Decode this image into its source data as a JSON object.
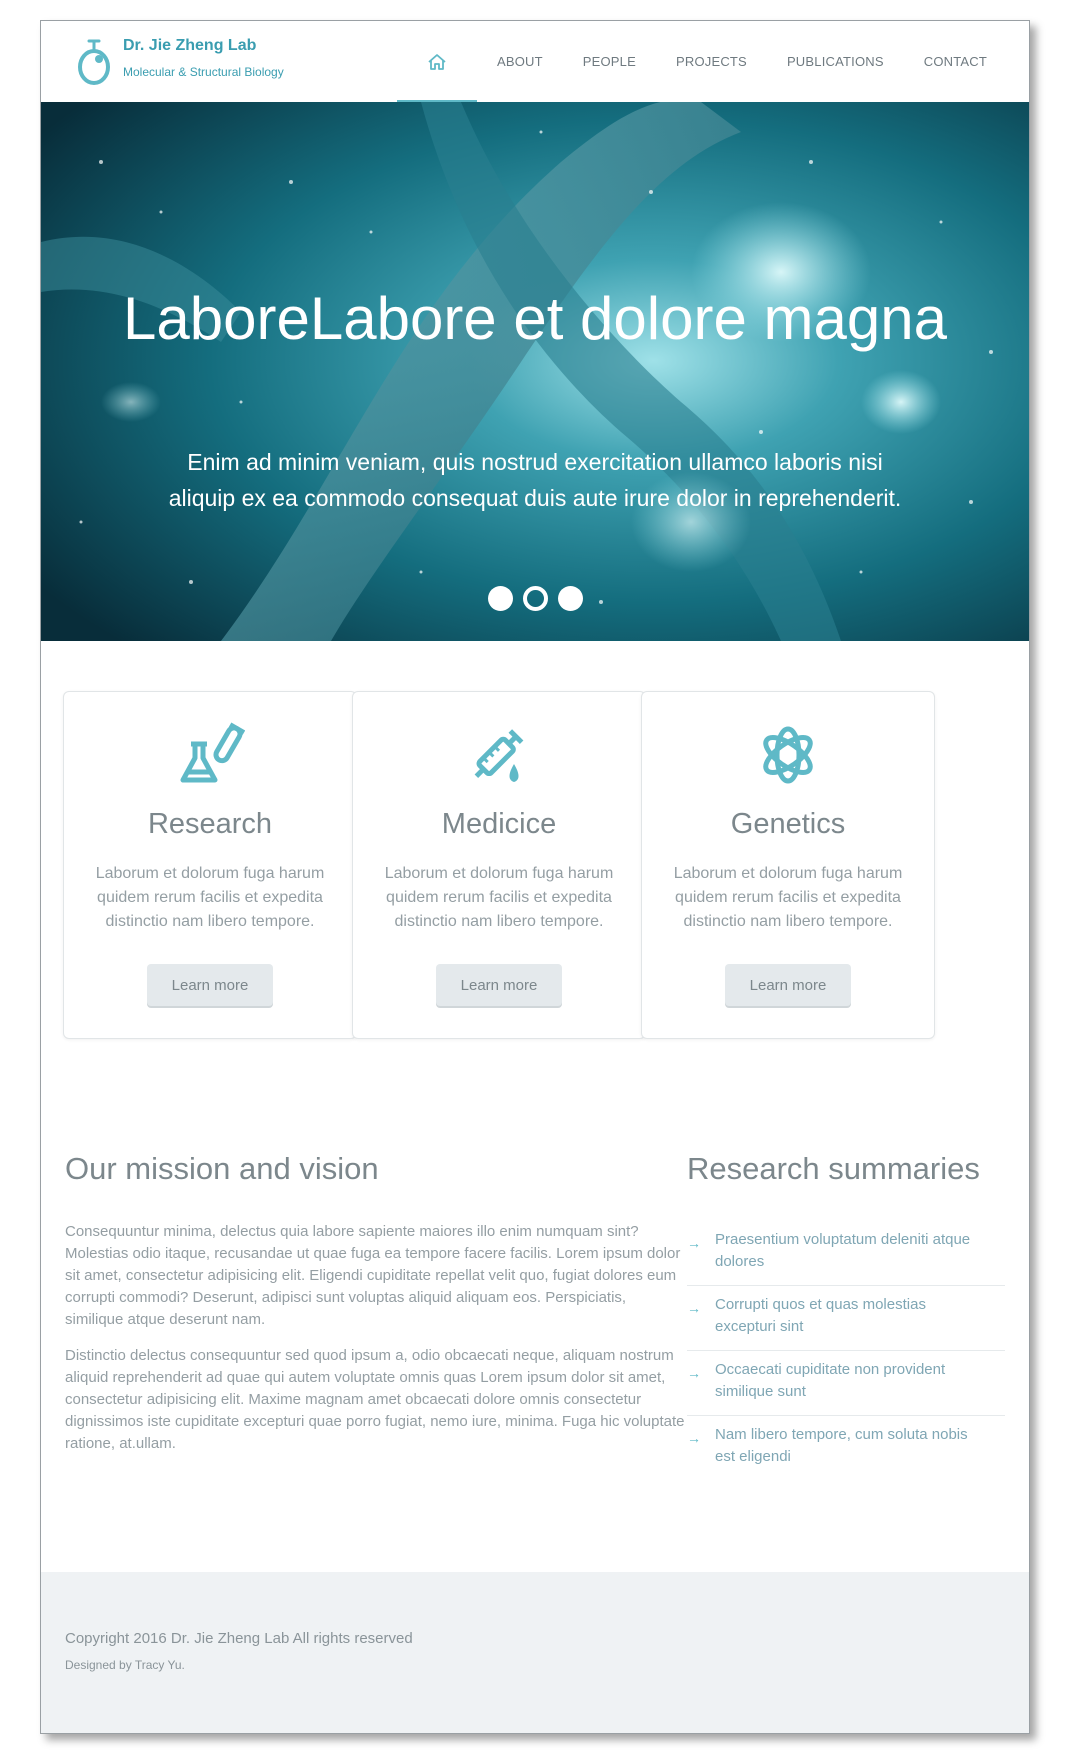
{
  "brand": {
    "title": "Dr. Jie Zheng Lab",
    "subtitle": "Molecular & Structural Biology"
  },
  "nav": {
    "items": [
      "ABOUT",
      "PEOPLE",
      "PROJECTS",
      "PUBLICATIONS",
      "CONTACT"
    ],
    "active": "home"
  },
  "hero": {
    "title": "LaboreLabore et dolore magna",
    "text": "Enim ad minim veniam, quis nostrud exercitation ullamco laboris nisi aliquip ex ea commodo consequat duis aute irure dolor in reprehenderit.",
    "slides": 3,
    "active_slide": 2
  },
  "cards": [
    {
      "title": "Research",
      "icon": "flask-icon",
      "text": "Laborum et dolorum fuga harum quidem rerum facilis et expedita distinctio nam libero tempore.",
      "button": "Learn more"
    },
    {
      "title": "Medicice",
      "icon": "syringe-icon",
      "text": "Laborum et dolorum fuga harum quidem rerum facilis et expedita distinctio nam libero tempore.",
      "button": "Learn more"
    },
    {
      "title": "Genetics",
      "icon": "atom-icon",
      "text": "Laborum et dolorum fuga harum quidem rerum facilis et expedita distinctio nam libero tempore.",
      "button": "Learn more"
    }
  ],
  "mission": {
    "title": "Our mission and vision",
    "paragraphs": [
      "Consequuntur minima, delectus quia labore sapiente maiores illo enim numquam sint? Molestias odio itaque, recusandae ut quae fuga ea tempore facere facilis. Lorem ipsum dolor sit amet, consectetur adipisicing elit. Eligendi cupiditate repellat velit quo, fugiat dolores eum corrupti commodi? Deserunt, adipisci sunt voluptas aliquid aliquam eos. Perspiciatis, similique atque deserunt nam.",
      "Distinctio delectus consequuntur sed quod ipsum a, odio obcaecati neque, aliquam nostrum aliquid reprehenderit ad quae qui autem voluptate omnis quas Lorem ipsum dolor sit amet, consectetur adipisicing elit. Maxime magnam amet obcaecati dolore omnis consectetur dignissimos iste cupiditate excepturi quae porro fugiat, nemo iure, minima. Fuga hic voluptate ratione, at.ullam."
    ]
  },
  "summaries": {
    "title": "Research summaries",
    "items": [
      "Praesentium voluptatum deleniti atque dolores",
      "Corrupti quos et quas molestias excepturi sint",
      "Occaecati cupiditate non provident similique sunt",
      "Nam libero tempore, cum soluta nobis est eligendi"
    ]
  },
  "footer": {
    "copyright": "Copyright 2016 Dr. Jie Zheng Lab All rights reserved",
    "designed": "Designed by Tracy Yu."
  },
  "colors": {
    "accent": "#5fb9c7",
    "brand": "#3a9db0",
    "footer_bg": "#eff2f4"
  }
}
